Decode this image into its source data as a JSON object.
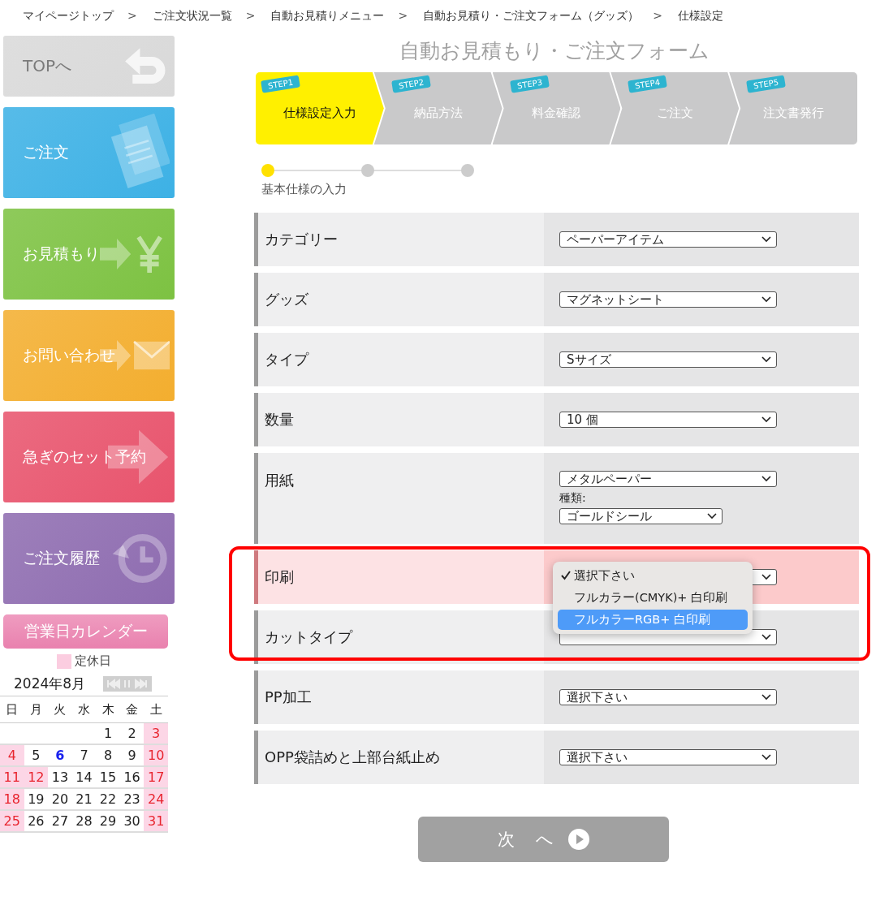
{
  "breadcrumb": {
    "separator": ">",
    "items": [
      "マイページトップ",
      "ご注文状況一覧",
      "自動お見積りメニュー",
      "自動お見積り・ご注文フォーム（グッズ）",
      "仕様設定"
    ]
  },
  "sidebar": {
    "items": [
      {
        "label": "TOPへ",
        "kind": "return",
        "color": "#d9d9d9"
      },
      {
        "label": "ご注文",
        "kind": "document",
        "color": "#3db1e5"
      },
      {
        "label": "お見積もり",
        "kind": "yen",
        "color": "#7dc242"
      },
      {
        "label": "お問い合わせ",
        "kind": "mail",
        "color": "#f3ae2f"
      },
      {
        "label": "急ぎのセット予約",
        "kind": "arrow",
        "color": "#e8546d"
      },
      {
        "label": "ご注文履歴",
        "kind": "history",
        "color": "#8e6cb0"
      }
    ]
  },
  "calendar": {
    "title": "営業日カレンダー",
    "legend": "定休日",
    "month": "2024年8月",
    "weekdays": [
      "日",
      "月",
      "火",
      "水",
      "木",
      "金",
      "土"
    ],
    "weeks": [
      [
        {
          "day": "1",
          "holiday": false,
          "today": false
        },
        {
          "day": "2",
          "holiday": false,
          "today": false
        },
        {
          "day": "3",
          "holiday": true,
          "today": false
        }
      ],
      [
        {
          "day": "4",
          "holiday": true,
          "today": false
        },
        {
          "day": "5",
          "holiday": false,
          "today": false
        },
        {
          "day": "6",
          "holiday": false,
          "today": true
        },
        {
          "day": "7",
          "holiday": false,
          "today": false
        },
        {
          "day": "8",
          "holiday": false,
          "today": false
        },
        {
          "day": "9",
          "holiday": false,
          "today": false
        },
        {
          "day": "10",
          "holiday": true,
          "today": false
        }
      ],
      [
        {
          "day": "11",
          "holiday": true,
          "today": false
        },
        {
          "day": "12",
          "holiday": true,
          "today": false
        },
        {
          "day": "13",
          "holiday": false,
          "today": false
        },
        {
          "day": "14",
          "holiday": false,
          "today": false
        },
        {
          "day": "15",
          "holiday": false,
          "today": false
        },
        {
          "day": "16",
          "holiday": false,
          "today": false
        },
        {
          "day": "17",
          "holiday": true,
          "today": false
        }
      ],
      [
        {
          "day": "18",
          "holiday": true,
          "today": false
        },
        {
          "day": "19",
          "holiday": false,
          "today": false
        },
        {
          "day": "20",
          "holiday": false,
          "today": false
        },
        {
          "day": "21",
          "holiday": false,
          "today": false
        },
        {
          "day": "22",
          "holiday": false,
          "today": false
        },
        {
          "day": "23",
          "holiday": false,
          "today": false
        },
        {
          "day": "24",
          "holiday": true,
          "today": false
        }
      ],
      [
        {
          "day": "25",
          "holiday": true,
          "today": false
        },
        {
          "day": "26",
          "holiday": false,
          "today": false
        },
        {
          "day": "27",
          "holiday": false,
          "today": false
        },
        {
          "day": "28",
          "holiday": false,
          "today": false
        },
        {
          "day": "29",
          "holiday": false,
          "today": false
        },
        {
          "day": "30",
          "holiday": false,
          "today": false
        },
        {
          "day": "31",
          "holiday": true,
          "today": false
        }
      ]
    ]
  },
  "title": "自動お見積もり・ご注文フォーム",
  "steps": [
    {
      "tag": "STEP1",
      "label": "仕様設定入力",
      "selected": true
    },
    {
      "tag": "STEP2",
      "label": "納品方法",
      "selected": false
    },
    {
      "tag": "STEP3",
      "label": "料金確認",
      "selected": false
    },
    {
      "tag": "STEP4",
      "label": "ご注文",
      "selected": false
    },
    {
      "tag": "STEP5",
      "label": "注文書発行",
      "selected": false
    }
  ],
  "progress": {
    "dots": [
      {
        "selected": true
      },
      {
        "selected": false
      },
      {
        "selected": false
      }
    ],
    "label": "基本仕様の入力"
  },
  "form": {
    "rows": [
      {
        "label": "カテゴリー",
        "alert": false,
        "value": "ペーパーアイテム"
      },
      {
        "label": "グッズ",
        "alert": false,
        "value": "マグネットシート"
      },
      {
        "label": "タイプ",
        "alert": false,
        "value": "Sサイズ"
      },
      {
        "label": "数量",
        "alert": false,
        "value": "10 個"
      },
      {
        "label": "用紙",
        "alert": false,
        "value": "メタルペーパー",
        "sub": {
          "label": "種類:",
          "value": "ゴールドシール"
        }
      },
      {
        "label": "印刷",
        "alert": true,
        "dropdown": [
          {
            "label": "選択下さい",
            "checked": true,
            "selected": false
          },
          {
            "label": "フルカラー(CMYK)+ 白印刷",
            "checked": false,
            "selected": false
          },
          {
            "label": "フルカラーRGB+ 白印刷",
            "checked": false,
            "selected": true
          }
        ]
      },
      {
        "label": "カットタイプ",
        "alert": false
      },
      {
        "label": "PP加工",
        "alert": false,
        "value": "選択下さい"
      },
      {
        "label": "OPP袋詰めと上部台紙止め",
        "alert": false,
        "value": "選択下さい"
      }
    ]
  },
  "next_button": "次 へ"
}
